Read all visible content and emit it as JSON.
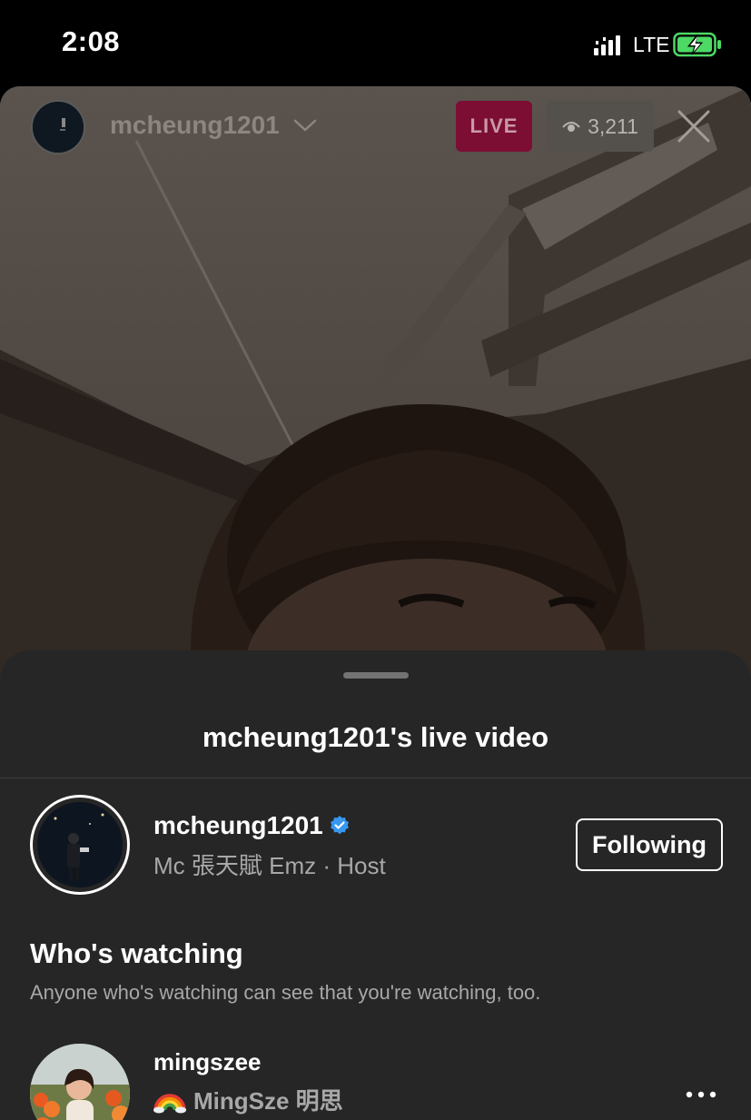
{
  "status_bar": {
    "time": "2:08",
    "network": "LTE",
    "icons": [
      "signal-icon",
      "battery-charging-icon"
    ]
  },
  "live": {
    "host_username": "mcheung1201",
    "live_label": "LIVE",
    "viewer_count": "3,211",
    "icons": [
      "chevron-down-icon",
      "eye-icon",
      "close-icon"
    ]
  },
  "sheet": {
    "title": "mcheung1201's live video",
    "host": {
      "username": "mcheung1201",
      "verified": true,
      "subtitle": "Mc 張天賦 Emz · Host",
      "follow_label": "Following"
    },
    "watching": {
      "title": "Who's watching",
      "description": "Anyone who's watching can see that you're watching, too."
    },
    "viewers": [
      {
        "username": "mingszee",
        "emoji_icon": "rainbow-icon",
        "full_name": "MingSze 明思"
      }
    ]
  },
  "colors": {
    "sheet_bg": "#262626",
    "live_badge": "#7c0e33",
    "verified_blue": "#3897f0",
    "secondary_text": "#a8a8a8"
  }
}
